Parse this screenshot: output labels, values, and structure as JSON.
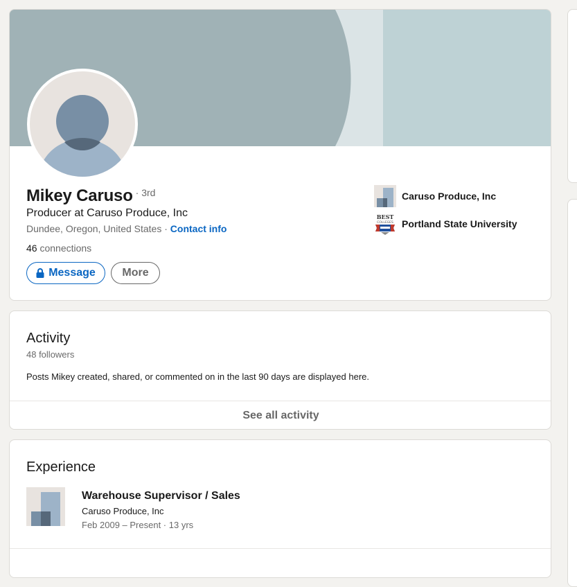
{
  "profile": {
    "name": "Mikey Caruso",
    "degree": "· 3rd",
    "headline": "Producer at Caruso Produce, Inc",
    "location": "Dundee, Oregon, United States · ",
    "contact_info": "Contact info",
    "connections_count": "46",
    "connections_label": " connections",
    "message_label": "Message",
    "more_label": "More",
    "organizations": [
      {
        "name": "Caruso Produce, Inc",
        "icon": "company-logo-icon"
      },
      {
        "name": "Portland State University",
        "icon": "best-colleges-badge-icon",
        "logo_text": "BEST COLLEGES"
      }
    ]
  },
  "activity": {
    "title": "Activity",
    "followers": "48 followers",
    "description": "Posts Mikey created, shared, or commented on in the last 90 days are displayed here.",
    "see_all": "See all activity"
  },
  "experience": {
    "title": "Experience",
    "items": [
      {
        "title": "Warehouse Supervisor / Sales",
        "company": "Caruso Produce, Inc",
        "dates": "Feb 2009 – Present · 13 yrs"
      }
    ]
  },
  "colors": {
    "accent": "#0a66c2",
    "page_background": "#f3f2ef",
    "banner_dark": "#a0b2b6",
    "banner_light": "#bed2d5"
  }
}
